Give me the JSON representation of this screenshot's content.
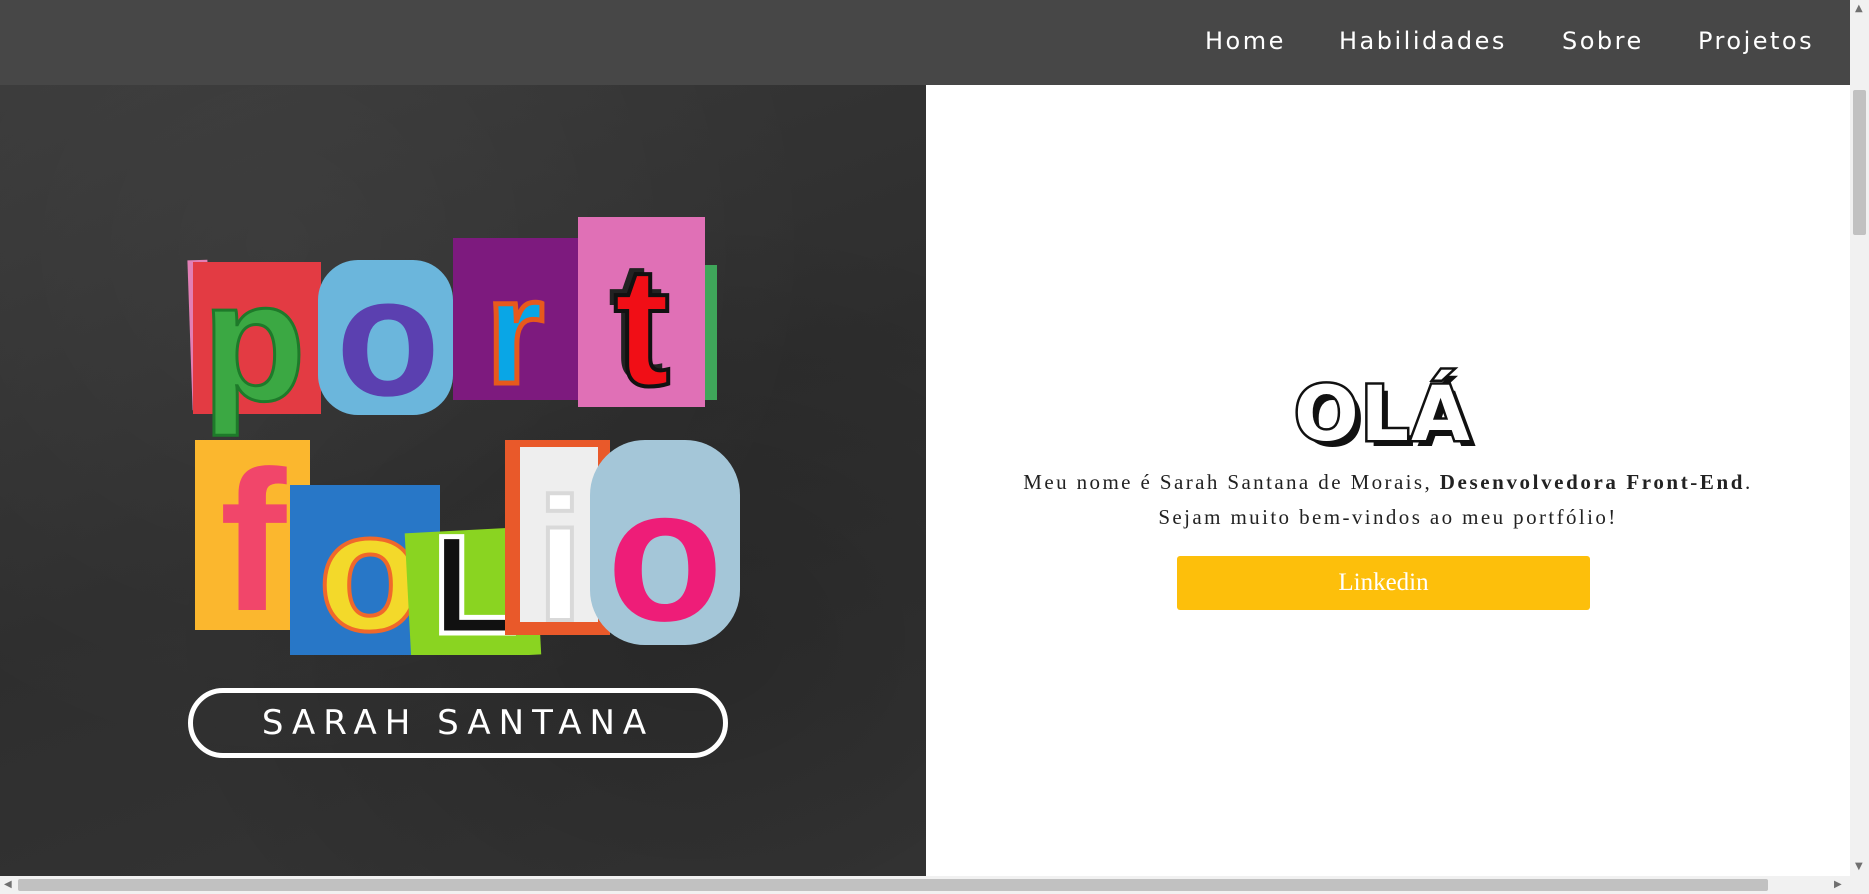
{
  "nav": {
    "items": [
      {
        "label": "Home"
      },
      {
        "label": "Habilidades"
      },
      {
        "label": "Sobre"
      },
      {
        "label": "Projetos"
      }
    ]
  },
  "hero": {
    "logo_text": "portfolio",
    "name_badge": "SARAH SANTANA"
  },
  "intro": {
    "greeting": "OLÁ",
    "line1_prefix": "Meu nome é Sarah Santana de Morais, ",
    "line1_bold": "Desenvolvedora Front-End",
    "line1_suffix": ".",
    "line2": "Sejam muito bem-vindos ao meu portfólio!",
    "button_label": "Linkedin"
  },
  "scrollbar_icons": {
    "up": "arrow-up-icon",
    "down": "arrow-down-icon",
    "left": "arrow-left-icon",
    "right": "arrow-right-icon"
  },
  "colors": {
    "nav_bg": "#474747",
    "left_bg": "#333333",
    "button_bg": "#fdbf0b",
    "text": "#222222"
  }
}
